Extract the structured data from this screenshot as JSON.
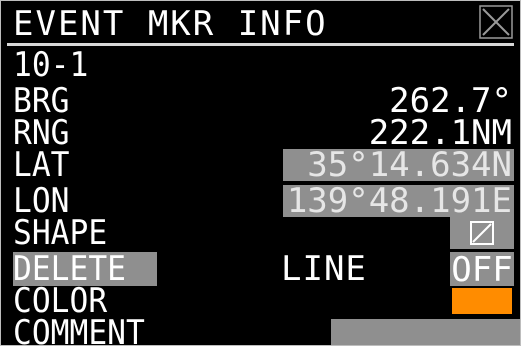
{
  "title": "EVENT MKR INFO",
  "marker_id": "10-1",
  "fields": {
    "brg": {
      "label": "BRG",
      "value": "262.7°"
    },
    "rng": {
      "label": "RNG",
      "value": "222.1NM"
    },
    "lat": {
      "label": "LAT",
      "value": "35°14.634N"
    },
    "lon": {
      "label": "LON",
      "value": "139°48.191E"
    },
    "shape": {
      "label": "SHAPE"
    },
    "delete": {
      "label": "DELETE",
      "mode": "LINE",
      "state": "OFF"
    },
    "color": {
      "label": "COLOR",
      "value_color": "#ff8c00"
    },
    "comment": {
      "label": "COMMENT",
      "value": ""
    }
  },
  "colors": {
    "background": "#000000",
    "text": "#ffffff",
    "highlight": "#8f8f8f",
    "accent": "#ff8c00"
  },
  "icons": {
    "close": "close-icon",
    "shape": "shape-slash-icon"
  }
}
